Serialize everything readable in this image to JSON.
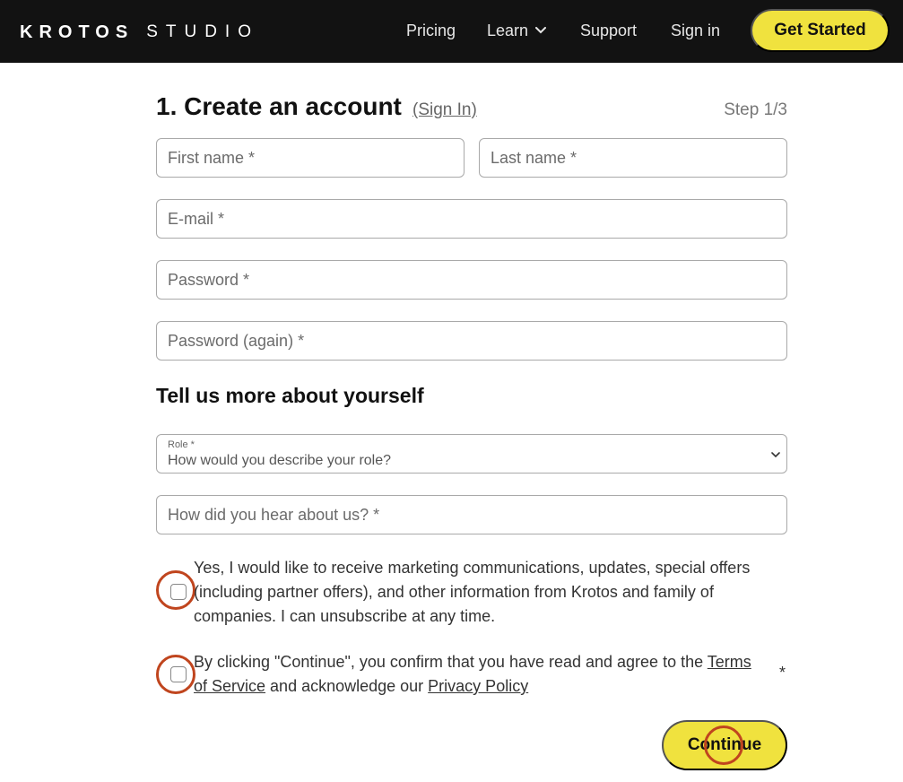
{
  "header": {
    "logo_mark": "KROTOS",
    "logo_product": "STUDIO",
    "nav": {
      "pricing": "Pricing",
      "learn": "Learn",
      "support": "Support",
      "sign_in": "Sign in"
    },
    "cta": "Get Started",
    "background": "#121212",
    "accent": "#f0e23e"
  },
  "form": {
    "title": "1. Create an account",
    "sign_in_link": "(Sign In)",
    "step": "Step 1/3",
    "fields": {
      "first_name": "First name *",
      "last_name": "Last name *",
      "email": "E-mail *",
      "password": "Password *",
      "password_again": "Password (again) *"
    },
    "about_heading": "Tell us more about yourself",
    "role": {
      "label": "Role *",
      "value": "How would you describe your role?"
    },
    "hear_about": "How did you hear about us? *",
    "marketing_consent": "Yes, I would like to receive marketing communications, updates, special offers (including partner offers), and other information from Krotos and family of companies. I can unsubscribe at any time.",
    "terms": {
      "prefix": "By clicking \"Continue\", you confirm that you have read and agree to the ",
      "terms_link": "Terms of Service",
      "middle": " and acknowledge our ",
      "privacy_link": "Privacy Policy",
      "required_mark": "*"
    },
    "continue": "Continue",
    "highlight_color": "#c0451e"
  }
}
